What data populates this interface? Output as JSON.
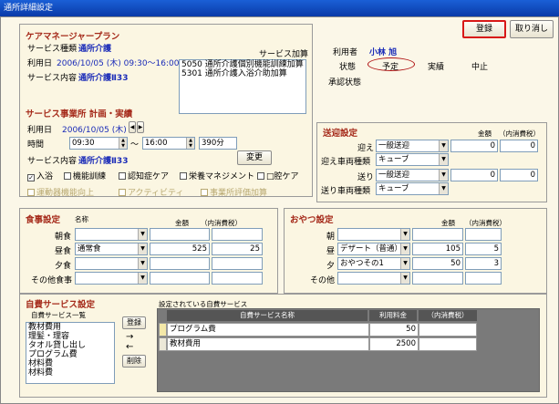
{
  "window": {
    "title": "通所詳細設定"
  },
  "toolbar": {
    "register_label": "登録",
    "cancel_label": "取り消し"
  },
  "careplan": {
    "title": "ケアマネージャープラン",
    "service_type_label": "サービス種類",
    "service_type_value": "通所介護",
    "use_date_label": "利用日",
    "use_date_value": "2006/10/05 (木) 09:30～16:00",
    "service_content_label": "サービス内容",
    "service_content_value": "通所介護Ⅱ33",
    "addon_label": "サービス加算",
    "addon_items": [
      "5050 通所介護個別機能訓練加算",
      "5301 通所介護入浴介助加算"
    ]
  },
  "user": {
    "user_label": "利用者",
    "user_name": "小林 旭",
    "status_label": "状態",
    "status_options": [
      "予定",
      "実績",
      "中止"
    ],
    "approval_label": "承認状態"
  },
  "plan": {
    "title": "サービス事業所 計画・実績",
    "date_label": "利用日",
    "date_value": "2006/10/05 (木)",
    "time_label": "時間",
    "time_from": "09:30",
    "time_sep": "～",
    "time_to": "16:00",
    "duration": "390分",
    "content_label": "サービス内容",
    "content_value": "通所介護Ⅱ33",
    "change_label": "変更",
    "checks_row1": [
      {
        "label": "入浴",
        "checked": true
      },
      {
        "label": "機能訓練",
        "checked": false
      },
      {
        "label": "認知症ケア",
        "checked": false
      },
      {
        "label": "栄養マネジメント",
        "checked": false
      },
      {
        "label": "□腔ケア",
        "checked": false
      }
    ],
    "checks_row2": [
      {
        "label": "運動器機能向上"
      },
      {
        "label": "アクティビティ"
      },
      {
        "label": "事業所評価加算"
      }
    ]
  },
  "transport": {
    "title": "送迎設定",
    "amount_header": "金額",
    "tax_header": "（内消費税）",
    "pickup_label": "迎え",
    "pickup_value": "一般送迎",
    "pickup_amount": "0",
    "pickup_tax": "0",
    "pickup_car_label": "迎え車両種類",
    "pickup_car_value": "キューブ",
    "dropoff_label": "送り",
    "dropoff_value": "一般送迎",
    "dropoff_amount": "0",
    "dropoff_tax": "0",
    "dropoff_car_label": "送り車両種類",
    "dropoff_car_value": "キューブ"
  },
  "meal": {
    "title": "食事設定",
    "name_header": "名称",
    "amount_header": "金額",
    "tax_header": "（内消費税）",
    "rows": [
      {
        "label": "朝食",
        "name": "",
        "amount": "",
        "tax": ""
      },
      {
        "label": "昼食",
        "name": "通常食",
        "amount": "525",
        "tax": "25"
      },
      {
        "label": "夕食",
        "name": "",
        "amount": "",
        "tax": ""
      },
      {
        "label": "その他食事",
        "name": "",
        "amount": "",
        "tax": ""
      }
    ]
  },
  "snack": {
    "title": "おやつ設定",
    "name_header": "名称",
    "amount_header": "金額",
    "tax_header": "（内消費税）",
    "rows": [
      {
        "label": "朝",
        "name": "",
        "amount": "",
        "tax": ""
      },
      {
        "label": "昼",
        "name": "デザート（普通）",
        "amount": "105",
        "tax": "5"
      },
      {
        "label": "夕",
        "name": "おやつその1",
        "amount": "50",
        "tax": "3"
      },
      {
        "label": "その他",
        "name": "",
        "amount": "",
        "tax": ""
      }
    ]
  },
  "selfpay": {
    "title": "自費サービス設定",
    "list_label": "自費サービス一覧",
    "list_items": [
      "教材費用",
      "理髪・理容",
      "タオル貸し出し",
      "プログラム費",
      "材料費",
      "材料費"
    ],
    "add_label": "登録",
    "arrow_right": "→",
    "arrow_left": "←",
    "delete_label": "削除",
    "set_label": "設定されている自費サービス",
    "col_name": "自費サービス名称",
    "col_fee": "利用料金",
    "col_tax": "（内消費税）",
    "rows": [
      {
        "name": "プログラム費",
        "fee": "50",
        "tax": ""
      },
      {
        "name": "教材費用",
        "fee": "2500",
        "tax": ""
      }
    ]
  }
}
